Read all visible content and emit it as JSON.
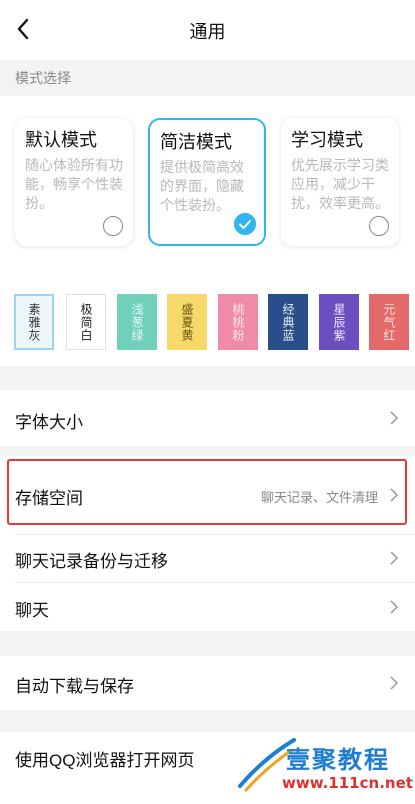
{
  "header": {
    "title": "通用"
  },
  "mode_section": {
    "label": "模式选择"
  },
  "modes": [
    {
      "title": "默认模式",
      "desc": "随心体验所有功能，畅享个性装扮。"
    },
    {
      "title": "简洁模式",
      "desc": "提供极简高效的界面，隐藏个性装扮。"
    },
    {
      "title": "学习模式",
      "desc": "优先展示学习类应用，减少干扰，效率更高。"
    }
  ],
  "selected_mode": "简洁模式",
  "themes": [
    {
      "label": "素雅灰",
      "bg": "#f7f7f7",
      "fg": "#333333"
    },
    {
      "label": "极简白",
      "bg": "#ffffff",
      "fg": "#222222"
    },
    {
      "label": "浅葱绿",
      "bg": "#6fd1b9",
      "fg": "#e7fbf5"
    },
    {
      "label": "盛夏黄",
      "bg": "#f6d96a",
      "fg": "#6a5210"
    },
    {
      "label": "桃桃粉",
      "bg": "#f08aa9",
      "fg": "#fde8ef"
    },
    {
      "label": "经典蓝",
      "bg": "#294f8a",
      "fg": "#e3ecf8"
    },
    {
      "label": "星辰紫",
      "bg": "#6b4ec0",
      "fg": "#efe9ff"
    },
    {
      "label": "元气红",
      "bg": "#e46a6a",
      "fg": "#fde3e3"
    }
  ],
  "selected_theme": "素雅灰",
  "settings": {
    "font_size": {
      "label": "字体大小"
    },
    "storage": {
      "label": "存储空间",
      "value": "聊天记录、文件清理"
    },
    "chat_backup": {
      "label": "聊天记录备份与迁移"
    },
    "chat": {
      "label": "聊天"
    },
    "auto_download": {
      "label": "自动下载与保存"
    },
    "browser": {
      "label": "使用QQ浏览器打开网页"
    }
  },
  "watermark": {
    "text": "壹聚教程",
    "url": "www.111cn.net"
  },
  "colors": {
    "accent": "#31b5ee",
    "highlight": "#e53935",
    "background": "#f2f3f5"
  }
}
